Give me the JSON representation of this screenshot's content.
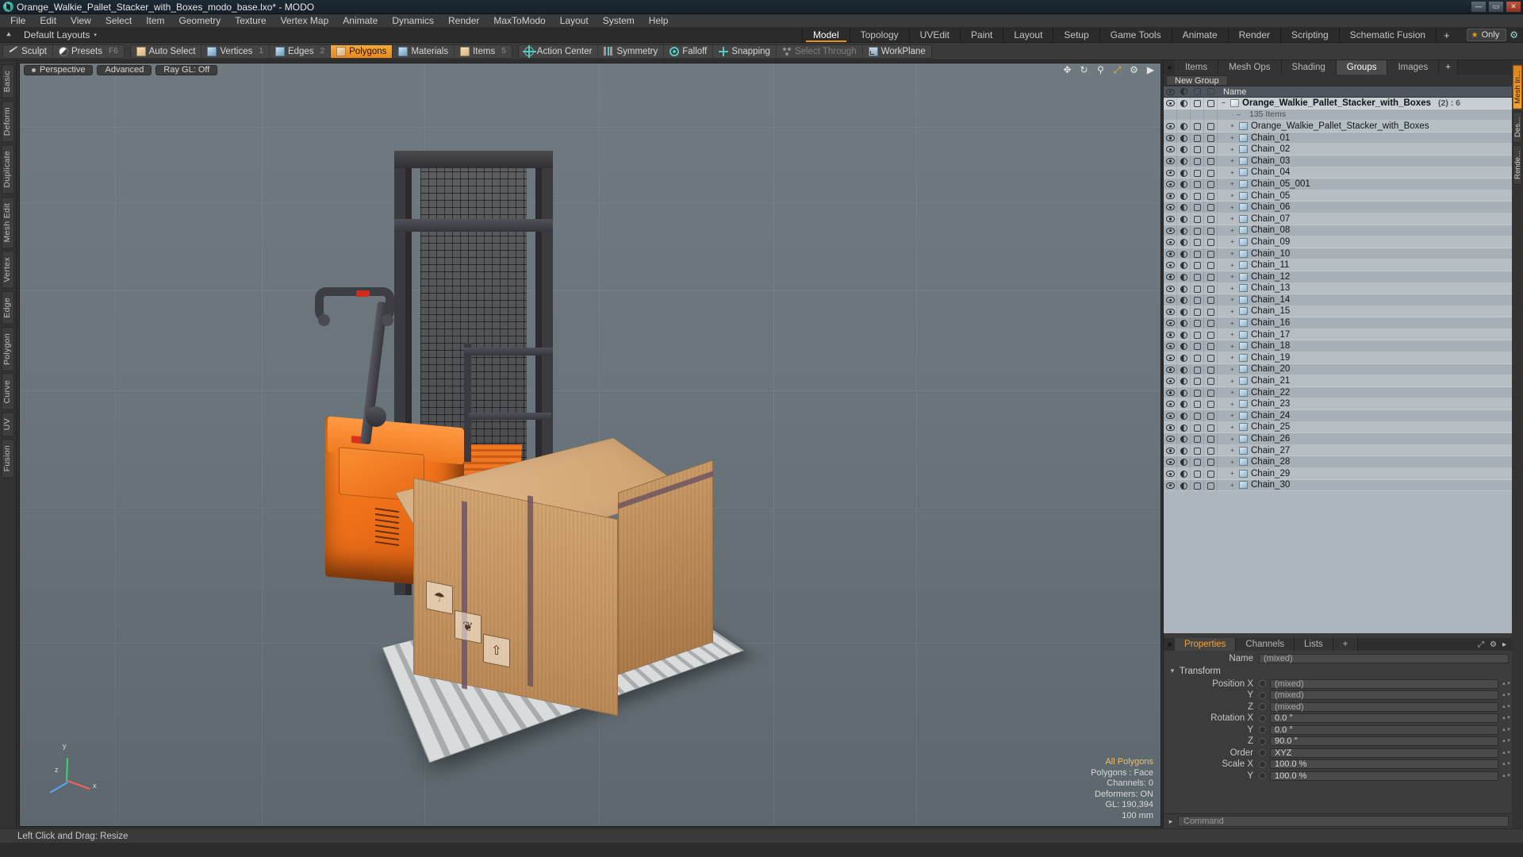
{
  "window": {
    "title": "Orange_Walkie_Pallet_Stacker_with_Boxes_modo_base.lxo* - MODO",
    "minimize": "—",
    "maximize": "▭",
    "close": "✕"
  },
  "menu": [
    "File",
    "Edit",
    "View",
    "Select",
    "Item",
    "Geometry",
    "Texture",
    "Vertex Map",
    "Animate",
    "Dynamics",
    "Render",
    "MaxToModo",
    "Layout",
    "System",
    "Help"
  ],
  "layoutbar": {
    "default_layouts": "Default Layouts",
    "caret": "▾",
    "tabs": [
      "Model",
      "Topology",
      "UVEdit",
      "Paint",
      "Layout",
      "Setup",
      "Game Tools",
      "Animate",
      "Render",
      "Scripting",
      "Schematic Fusion"
    ],
    "active_tab": "Model",
    "plus": "+",
    "only_label": "Only",
    "star_icon": "★",
    "gear_icon": "⚙"
  },
  "modebar": {
    "group1": [
      {
        "label": "Sculpt",
        "icon": "sculpt-icon",
        "shortcut": "",
        "active": false
      },
      {
        "label": "Presets",
        "icon": "presets-ball-icon",
        "shortcut": "F6",
        "active": false
      }
    ],
    "group2": [
      {
        "label": "Auto Select",
        "icon": "cube-icon",
        "shortcut": "",
        "active": false
      },
      {
        "label": "Vertices",
        "icon": "cube-icon",
        "shortcut": "1",
        "active": false
      },
      {
        "label": "Edges",
        "icon": "cube-icon",
        "shortcut": "2",
        "active": false
      },
      {
        "label": "Polygons",
        "icon": "cube-icon",
        "shortcut": "",
        "active": true
      },
      {
        "label": "Materials",
        "icon": "cube-icon",
        "shortcut": "",
        "active": false
      },
      {
        "label": "Items",
        "icon": "cube-icon",
        "shortcut": "5",
        "active": false
      }
    ],
    "group3": [
      {
        "label": "Action Center",
        "icon": "action-center-icon",
        "active": false
      },
      {
        "label": "Symmetry",
        "icon": "symmetry-icon",
        "active": false
      },
      {
        "label": "Falloff",
        "icon": "falloff-icon",
        "active": false
      },
      {
        "label": "Snapping",
        "icon": "snapping-icon",
        "active": false
      },
      {
        "label": "Select Through",
        "icon": "select-through-icon",
        "dim": true
      },
      {
        "label": "WorkPlane",
        "icon": "workplane-icon",
        "active": false
      }
    ]
  },
  "left_tabs": [
    "Basic",
    "Deform",
    "Duplicate",
    "Mesh Edit",
    "Vertex",
    "Edge",
    "Polygon",
    "Curve",
    "UV",
    "Fusion"
  ],
  "viewport": {
    "pill_perspective": "Perspective",
    "pill_advanced": "Advanced",
    "pill_raygl": "Ray GL: Off",
    "icons": [
      "move-icon",
      "rotate-icon",
      "zoom-icon",
      "fit-icon",
      "gear-icon",
      "play-icon"
    ],
    "axis_labels": {
      "x": "x",
      "y": "y",
      "z": "z"
    },
    "hud": {
      "title": "All Polygons",
      "lines": [
        "Polygons : Face",
        "Channels: 0",
        "Deformers: ON",
        "GL: 190,394",
        "100 mm"
      ]
    }
  },
  "right_panel": {
    "tabs": [
      "Items",
      "Mesh Ops",
      "Shading",
      "Groups",
      "Images"
    ],
    "active_tab": "Groups",
    "plus": "+",
    "new_group_label": "New Group",
    "column_headers": {
      "visible": "eye-icon",
      "shade": "shade-icon",
      "lock": "cube-icon",
      "render": "cube-solid-icon",
      "name": "Name"
    },
    "items": [
      {
        "name": "Orange_Walkie_Pallet_Stacker_with_Boxes",
        "badge": "(2) : 6",
        "type": "group",
        "bold": true
      },
      {
        "name": "135 Items",
        "type": "count"
      },
      {
        "name": "Orange_Walkie_Pallet_Stacker_with_Boxes",
        "type": "mesh"
      },
      {
        "name": "Chain_01",
        "type": "mesh"
      },
      {
        "name": "Chain_02",
        "type": "mesh"
      },
      {
        "name": "Chain_03",
        "type": "mesh"
      },
      {
        "name": "Chain_04",
        "type": "mesh"
      },
      {
        "name": "Chain_05_001",
        "type": "mesh"
      },
      {
        "name": "Chain_05",
        "type": "mesh"
      },
      {
        "name": "Chain_06",
        "type": "mesh"
      },
      {
        "name": "Chain_07",
        "type": "mesh"
      },
      {
        "name": "Chain_08",
        "type": "mesh"
      },
      {
        "name": "Chain_09",
        "type": "mesh"
      },
      {
        "name": "Chain_10",
        "type": "mesh"
      },
      {
        "name": "Chain_11",
        "type": "mesh"
      },
      {
        "name": "Chain_12",
        "type": "mesh"
      },
      {
        "name": "Chain_13",
        "type": "mesh"
      },
      {
        "name": "Chain_14",
        "type": "mesh"
      },
      {
        "name": "Chain_15",
        "type": "mesh"
      },
      {
        "name": "Chain_16",
        "type": "mesh"
      },
      {
        "name": "Chain_17",
        "type": "mesh"
      },
      {
        "name": "Chain_18",
        "type": "mesh"
      },
      {
        "name": "Chain_19",
        "type": "mesh"
      },
      {
        "name": "Chain_20",
        "type": "mesh"
      },
      {
        "name": "Chain_21",
        "type": "mesh"
      },
      {
        "name": "Chain_22",
        "type": "mesh"
      },
      {
        "name": "Chain_23",
        "type": "mesh"
      },
      {
        "name": "Chain_24",
        "type": "mesh"
      },
      {
        "name": "Chain_25",
        "type": "mesh"
      },
      {
        "name": "Chain_26",
        "type": "mesh"
      },
      {
        "name": "Chain_27",
        "type": "mesh"
      },
      {
        "name": "Chain_28",
        "type": "mesh"
      },
      {
        "name": "Chain_29",
        "type": "mesh"
      },
      {
        "name": "Chain_30",
        "type": "mesh"
      }
    ]
  },
  "properties": {
    "tabs": [
      "Properties",
      "Channels",
      "Lists"
    ],
    "active_tab": "Properties",
    "plus": "+",
    "name_label": "Name",
    "name_value": "(mixed)",
    "transform_section": "Transform",
    "rows": [
      {
        "label": "Position X",
        "value": "(mixed)"
      },
      {
        "label": "Y",
        "value": "(mixed)"
      },
      {
        "label": "Z",
        "value": "(mixed)"
      },
      {
        "label": "Rotation X",
        "value": "0.0 °"
      },
      {
        "label": "Y",
        "value": "0.0 °"
      },
      {
        "label": "Z",
        "value": "90.0 °"
      },
      {
        "label": "Order",
        "value": "XYZ"
      },
      {
        "label": "Scale X",
        "value": "100.0 %"
      },
      {
        "label": "Y",
        "value": "100.0 %"
      }
    ]
  },
  "command_bar": {
    "arrow": "▸",
    "placeholder": "Command"
  },
  "right_tabs": [
    "Mesh In...",
    "Des...",
    "Rende..."
  ],
  "statusbar": {
    "text": "Left Click and Drag:  Resize"
  },
  "colors": {
    "accent": "#e8941f",
    "orange_model": "#f2731a",
    "panel_bg": "#3a3a3a",
    "list_bg": "#aeb6bd",
    "viewport_bg": "#6a757b"
  }
}
